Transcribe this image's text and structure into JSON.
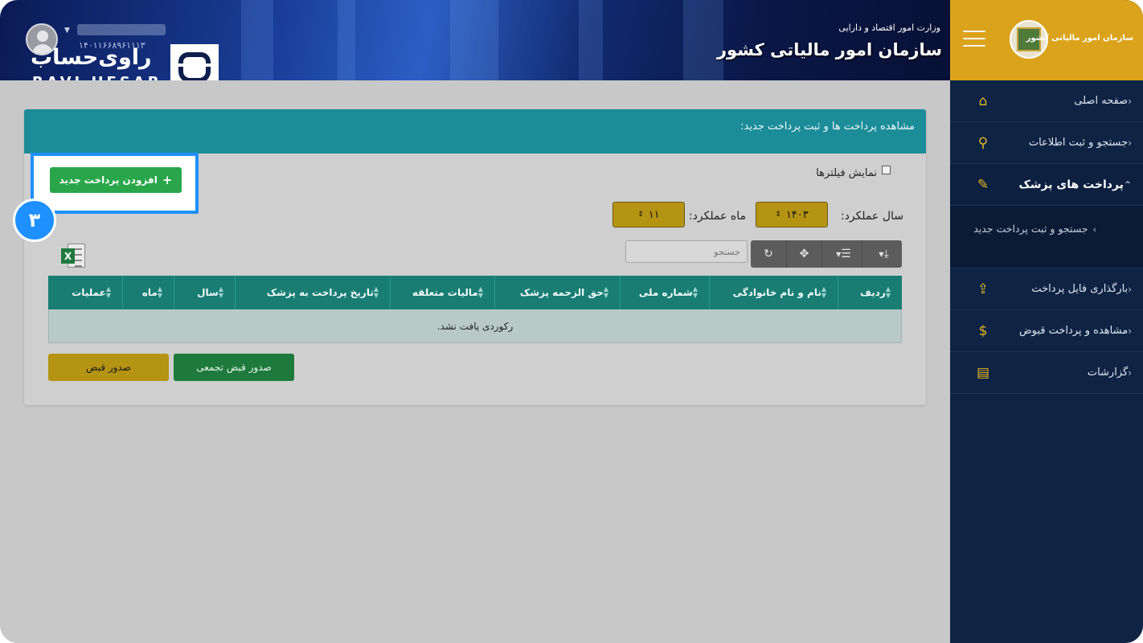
{
  "header": {
    "ministry": "وزارت امور اقتصاد و دارایی",
    "org_title": "سازمان امور مالیاتی کشور",
    "user_id": "۱۴۰۱۱۶۶۸۹۶۱۱۱۳",
    "brand_fa": "راوی‌حساب",
    "brand_en": "RAVI HESAB"
  },
  "sidebar": {
    "org_name": "سازمان امور مالیاتی کشور",
    "items": [
      {
        "label": "صفحه اصلی",
        "icon": "⌂"
      },
      {
        "label": "جستجو و ثبت اطلاعات",
        "icon": "⚲"
      },
      {
        "label": "پرداخت های پزشک",
        "icon": "✎"
      },
      {
        "label": "بارگذاری فایل پرداخت",
        "icon": "⇪"
      },
      {
        "label": "مشاهده و پرداخت قبوض",
        "icon": "$"
      },
      {
        "label": "گزارشات",
        "icon": "▤"
      }
    ],
    "sub_item": "جستجو و ثبت پرداخت جدید"
  },
  "panel": {
    "title": "مشاهده پرداخت ها و ثبت پرداخت جدید:",
    "add_button": "افزودن پرداخت جدید",
    "step_number": "۳",
    "show_filters": "نمایش فیلترها",
    "year_label": "سال عملکرد:",
    "year_value": "۱۴۰۳",
    "month_label": "ماه عملکرد:",
    "month_value": "۱۱",
    "search_placeholder": "جستجو",
    "columns": [
      "ردیف",
      "نام و نام خانوادگی",
      "شماره ملی",
      "حق الزحمه پزشک",
      "مالیات متعلقه",
      "تاریخ پرداخت به پزشک",
      "سال",
      "ماه",
      "عملیات"
    ],
    "empty_message": "رکوردی یافت نشد.",
    "btn_receipt": "صدور قبض",
    "btn_bulk_receipt": "صدور قبض تجمعی"
  },
  "colors": {
    "sidebar_bg": "#0f2444",
    "sidebar_top": "#dba31c",
    "panel_header": "#1c8c98",
    "grid_header": "#197d74",
    "highlight": "#1e90ff",
    "green_button": "#2aa64a",
    "yellow_button": "#b69413"
  }
}
